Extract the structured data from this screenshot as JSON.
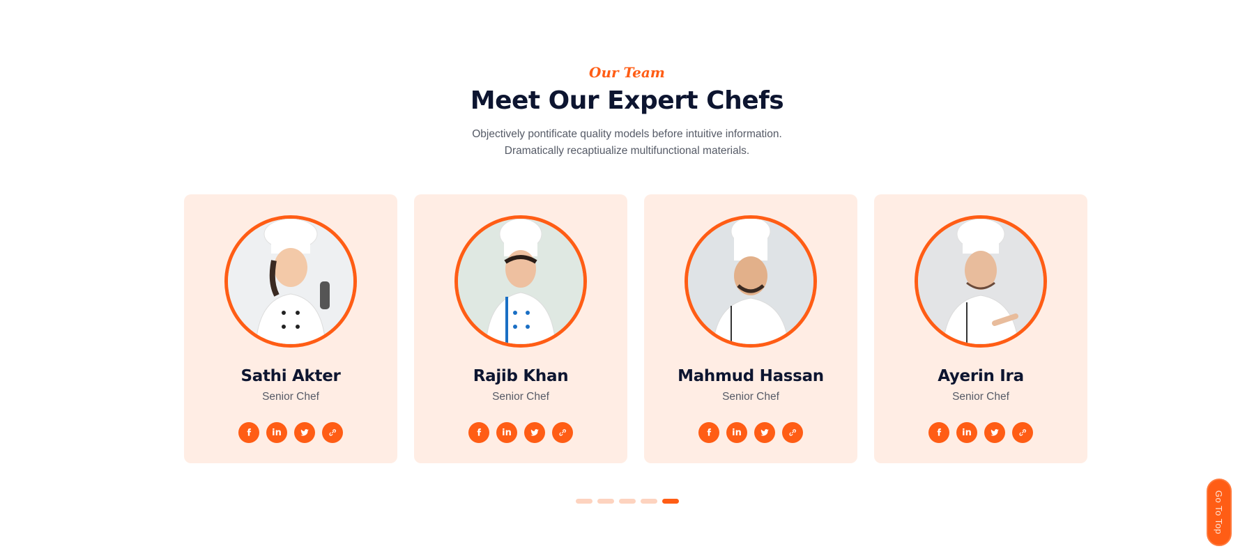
{
  "header": {
    "eyebrow": "Our Team",
    "title": "Meet Our Expert Chefs",
    "subtitle_line1": "Objectively pontificate quality models before intuitive information.",
    "subtitle_line2": "Dramatically recaptiualize multifunctional materials."
  },
  "chefs": [
    {
      "name": "Sathi Akter",
      "role": "Senior Chef"
    },
    {
      "name": "Rajib Khan",
      "role": "Senior Chef"
    },
    {
      "name": "Mahmud Hassan",
      "role": "Senior Chef"
    },
    {
      "name": "Ayerin Ira",
      "role": "Senior Chef"
    }
  ],
  "social_icons": [
    "facebook-icon",
    "linkedin-icon",
    "twitter-icon",
    "link-icon"
  ],
  "pagination": {
    "total": 5,
    "active": 5
  },
  "go_to_top": "Go To Top",
  "colors": {
    "accent": "#ff5d15",
    "card_bg": "#ffede4",
    "heading": "#0d1530",
    "text": "#555a66"
  }
}
